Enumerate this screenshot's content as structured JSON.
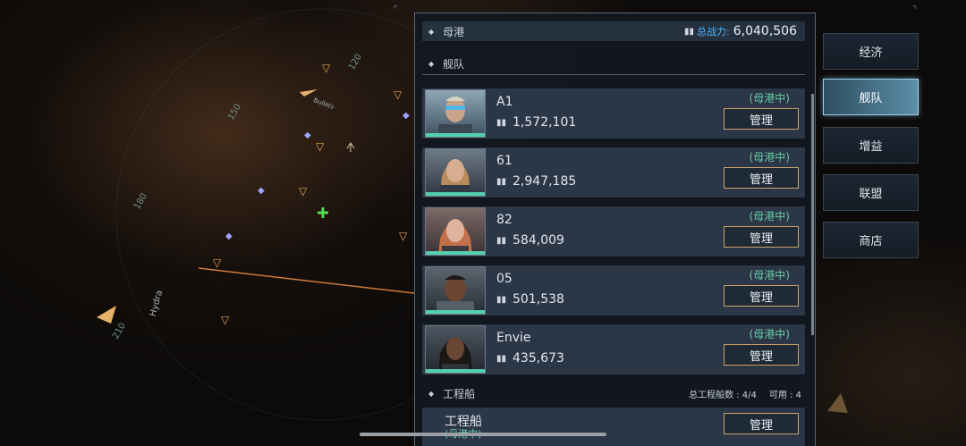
{
  "map": {
    "labels": [
      "120",
      "150",
      "180",
      "210"
    ],
    "names": [
      "Hydra",
      "Bullets"
    ],
    "markers": [
      "IV",
      "II",
      "IV",
      "IV",
      "IV",
      "IV",
      "III"
    ]
  },
  "panel": {
    "home_port_label": "母港",
    "total_power_label": "总战力:",
    "total_power_value": "6,040,506",
    "fleet_label": "舰队",
    "manage_label": "管理",
    "fleets": [
      {
        "name": "A1",
        "power": "1,572,101",
        "status": "(母港中)"
      },
      {
        "name": "61",
        "power": "2,947,185",
        "status": "(母港中)"
      },
      {
        "name": "82",
        "power": "584,009",
        "status": "(母港中)"
      },
      {
        "name": "05",
        "power": "501,538",
        "status": "(母港中)"
      },
      {
        "name": "Envie",
        "power": "435,673",
        "status": "(母港中)"
      }
    ],
    "eng_label": "工程船",
    "eng_total": "总工程船数 : 4/4",
    "eng_available": "可用 : 4",
    "eng_card": {
      "name": "工程船",
      "status": "(母港中)"
    }
  },
  "nav": {
    "items": [
      "经济",
      "舰队",
      "增益",
      "联盟",
      "商店"
    ],
    "active": "舰队"
  },
  "colors": {
    "accent": "#4fb5ff",
    "status": "#68c9a6",
    "button_border": "#c9a46a",
    "active_tab": "#5c8fa8"
  }
}
